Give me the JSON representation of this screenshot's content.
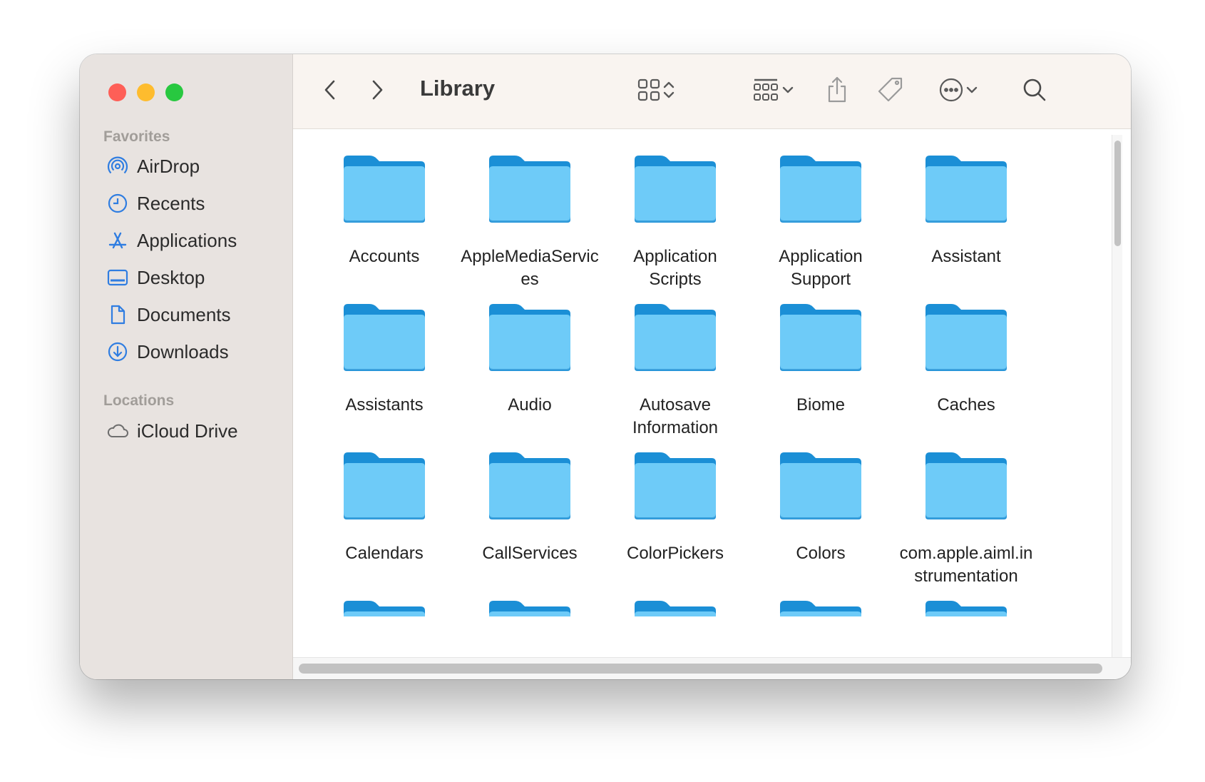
{
  "window": {
    "title": "Library"
  },
  "sidebar": {
    "favorites_header": "Favorites",
    "favorites": [
      {
        "label": "AirDrop",
        "icon": "airdrop-icon"
      },
      {
        "label": "Recents",
        "icon": "clock-icon"
      },
      {
        "label": "Applications",
        "icon": "applications-icon"
      },
      {
        "label": "Desktop",
        "icon": "desktop-icon"
      },
      {
        "label": "Documents",
        "icon": "document-icon"
      },
      {
        "label": "Downloads",
        "icon": "download-icon"
      }
    ],
    "locations_header": "Locations",
    "locations": [
      {
        "label": "iCloud Drive",
        "icon": "cloud-icon"
      }
    ]
  },
  "toolbar": {
    "back": "chevron-left-icon",
    "forward": "chevron-right-icon",
    "view_mode": "grid-view-icon",
    "group": "group-icon",
    "share": "share-icon",
    "tags": "tag-icon",
    "actions": "ellipsis-circle-icon",
    "search": "search-icon"
  },
  "items": [
    [
      "Accounts",
      "AppleMediaServic",
      "es"
    ],
    [
      "AppleMediaServic",
      "es"
    ],
    [
      "Application",
      "Scripts"
    ],
    [
      "Application",
      "Support"
    ],
    [
      "Assistant"
    ],
    [
      "Assistants"
    ],
    [
      "Audio"
    ],
    [
      "Autosave",
      "Information"
    ],
    [
      "Biome"
    ],
    [
      "Caches"
    ],
    [
      "Calendars"
    ],
    [
      "CallServices"
    ],
    [
      "ColorPickers"
    ],
    [
      "Colors"
    ],
    [
      "com.apple.aiml.in",
      "strumentation"
    ]
  ],
  "colors": {
    "folder_front": "#6ecbf8",
    "folder_back": "#1b8fd6",
    "accent": "#2f7de1"
  }
}
